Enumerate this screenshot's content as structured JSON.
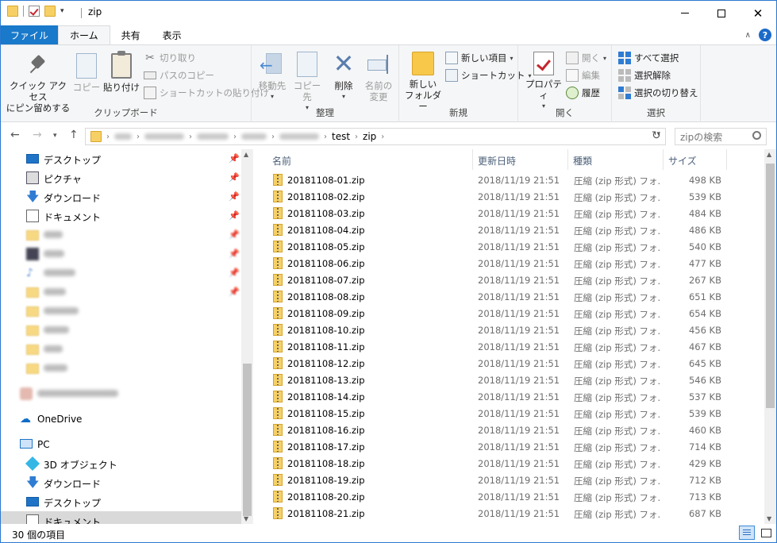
{
  "window": {
    "title": "zip"
  },
  "tabs": {
    "file": "ファイル",
    "home": "ホーム",
    "share": "共有",
    "view": "表示"
  },
  "ribbon": {
    "clipboard": {
      "label": "クリップボード",
      "pin_line1": "クイック アクセス",
      "pin_line2": "にピン留めする",
      "copy": "コピー",
      "paste": "貼り付け",
      "cut": "切り取り",
      "copy_path": "パスのコピー",
      "paste_shortcut": "ショートカットの貼り付け"
    },
    "organize": {
      "label": "整理",
      "move_to": "移動先",
      "copy_to": "コピー先",
      "delete": "削除",
      "rename_line1": "名前の",
      "rename_line2": "変更"
    },
    "new": {
      "label": "新規",
      "new_folder_line1": "新しい",
      "new_folder_line2": "フォルダー",
      "new_item": "新しい項目",
      "easy_access": "ショートカット"
    },
    "open": {
      "label": "開く",
      "properties": "プロパティ",
      "open": "開く",
      "edit": "編集",
      "history": "履歴"
    },
    "select": {
      "label": "選択",
      "select_all": "すべて選択",
      "select_none": "選択解除",
      "invert": "選択の切り替え"
    }
  },
  "address": {
    "crumbs": [
      "test",
      "zip"
    ],
    "search_placeholder": "zipの検索"
  },
  "nav": {
    "quick": [
      {
        "label": "デスクトップ",
        "icon": "desktop-icon"
      },
      {
        "label": "ピクチャ",
        "icon": "pictures-icon"
      },
      {
        "label": "ダウンロード",
        "icon": "download-icon"
      },
      {
        "label": "ドキュメント",
        "icon": "documents-icon"
      }
    ],
    "onedrive": "OneDrive",
    "pc": "PC",
    "pc_items": [
      {
        "label": "3D オブジェクト",
        "icon": "3d-objects-icon"
      },
      {
        "label": "ダウンロード",
        "icon": "download-icon"
      },
      {
        "label": "デスクトップ",
        "icon": "desktop-icon"
      },
      {
        "label": "ドキュメント",
        "icon": "documents-icon"
      }
    ]
  },
  "columns": {
    "name": "名前",
    "date": "更新日時",
    "type": "種類",
    "size": "サイズ"
  },
  "files": [
    {
      "name": "20181108-01.zip",
      "date": "2018/11/19 21:51",
      "type": "圧縮 (zip 形式) フォ...",
      "size": "498 KB"
    },
    {
      "name": "20181108-02.zip",
      "date": "2018/11/19 21:51",
      "type": "圧縮 (zip 形式) フォ...",
      "size": "539 KB"
    },
    {
      "name": "20181108-03.zip",
      "date": "2018/11/19 21:51",
      "type": "圧縮 (zip 形式) フォ...",
      "size": "484 KB"
    },
    {
      "name": "20181108-04.zip",
      "date": "2018/11/19 21:51",
      "type": "圧縮 (zip 形式) フォ...",
      "size": "486 KB"
    },
    {
      "name": "20181108-05.zip",
      "date": "2018/11/19 21:51",
      "type": "圧縮 (zip 形式) フォ...",
      "size": "540 KB"
    },
    {
      "name": "20181108-06.zip",
      "date": "2018/11/19 21:51",
      "type": "圧縮 (zip 形式) フォ...",
      "size": "477 KB"
    },
    {
      "name": "20181108-07.zip",
      "date": "2018/11/19 21:51",
      "type": "圧縮 (zip 形式) フォ...",
      "size": "267 KB"
    },
    {
      "name": "20181108-08.zip",
      "date": "2018/11/19 21:51",
      "type": "圧縮 (zip 形式) フォ...",
      "size": "651 KB"
    },
    {
      "name": "20181108-09.zip",
      "date": "2018/11/19 21:51",
      "type": "圧縮 (zip 形式) フォ...",
      "size": "654 KB"
    },
    {
      "name": "20181108-10.zip",
      "date": "2018/11/19 21:51",
      "type": "圧縮 (zip 形式) フォ...",
      "size": "456 KB"
    },
    {
      "name": "20181108-11.zip",
      "date": "2018/11/19 21:51",
      "type": "圧縮 (zip 形式) フォ...",
      "size": "467 KB"
    },
    {
      "name": "20181108-12.zip",
      "date": "2018/11/19 21:51",
      "type": "圧縮 (zip 形式) フォ...",
      "size": "645 KB"
    },
    {
      "name": "20181108-13.zip",
      "date": "2018/11/19 21:51",
      "type": "圧縮 (zip 形式) フォ...",
      "size": "546 KB"
    },
    {
      "name": "20181108-14.zip",
      "date": "2018/11/19 21:51",
      "type": "圧縮 (zip 形式) フォ...",
      "size": "537 KB"
    },
    {
      "name": "20181108-15.zip",
      "date": "2018/11/19 21:51",
      "type": "圧縮 (zip 形式) フォ...",
      "size": "539 KB"
    },
    {
      "name": "20181108-16.zip",
      "date": "2018/11/19 21:51",
      "type": "圧縮 (zip 形式) フォ...",
      "size": "460 KB"
    },
    {
      "name": "20181108-17.zip",
      "date": "2018/11/19 21:51",
      "type": "圧縮 (zip 形式) フォ...",
      "size": "714 KB"
    },
    {
      "name": "20181108-18.zip",
      "date": "2018/11/19 21:51",
      "type": "圧縮 (zip 形式) フォ...",
      "size": "429 KB"
    },
    {
      "name": "20181108-19.zip",
      "date": "2018/11/19 21:51",
      "type": "圧縮 (zip 形式) フォ...",
      "size": "712 KB"
    },
    {
      "name": "20181108-20.zip",
      "date": "2018/11/19 21:51",
      "type": "圧縮 (zip 形式) フォ...",
      "size": "713 KB"
    },
    {
      "name": "20181108-21.zip",
      "date": "2018/11/19 21:51",
      "type": "圧縮 (zip 形式) フォ...",
      "size": "687 KB"
    }
  ],
  "status": {
    "item_count": "30 個の項目"
  },
  "colors": {
    "file_tab": "#1979ca",
    "border": "#2b79d0"
  }
}
